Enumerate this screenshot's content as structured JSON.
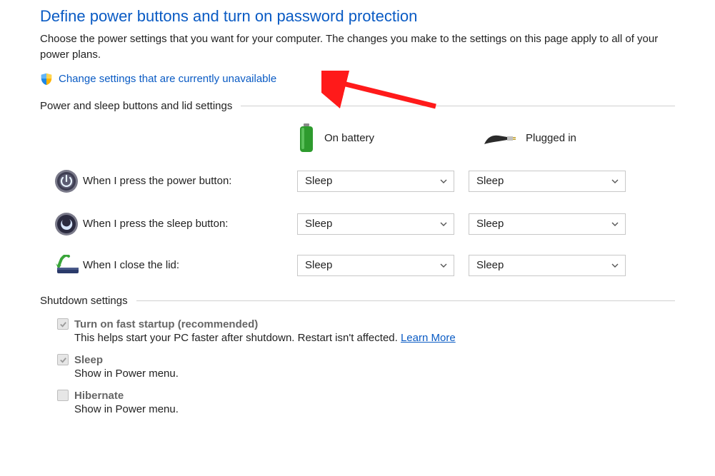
{
  "header": {
    "title": "Define power buttons and turn on password protection",
    "description": "Choose the power settings that you want for your computer. The changes you make to the settings on this page apply to all of your power plans.",
    "change_link": "Change settings that are currently unavailable"
  },
  "section1": {
    "title": "Power and sleep buttons and lid settings",
    "col_battery": "On battery",
    "col_plugged": "Plugged in",
    "rows": [
      {
        "label": "When I press the power button:",
        "battery": "Sleep",
        "plugged": "Sleep"
      },
      {
        "label": "When I press the sleep button:",
        "battery": "Sleep",
        "plugged": "Sleep"
      },
      {
        "label": "When I close the lid:",
        "battery": "Sleep",
        "plugged": "Sleep"
      }
    ]
  },
  "section2": {
    "title": "Shutdown settings",
    "items": [
      {
        "label": "Turn on fast startup (recommended)",
        "sub_pre": "This helps start your PC faster after shutdown. Restart isn't affected. ",
        "learn": "Learn More",
        "checked": true
      },
      {
        "label": "Sleep",
        "sub": "Show in Power menu.",
        "checked": true
      },
      {
        "label": "Hibernate",
        "sub": "Show in Power menu.",
        "checked": false
      }
    ]
  }
}
